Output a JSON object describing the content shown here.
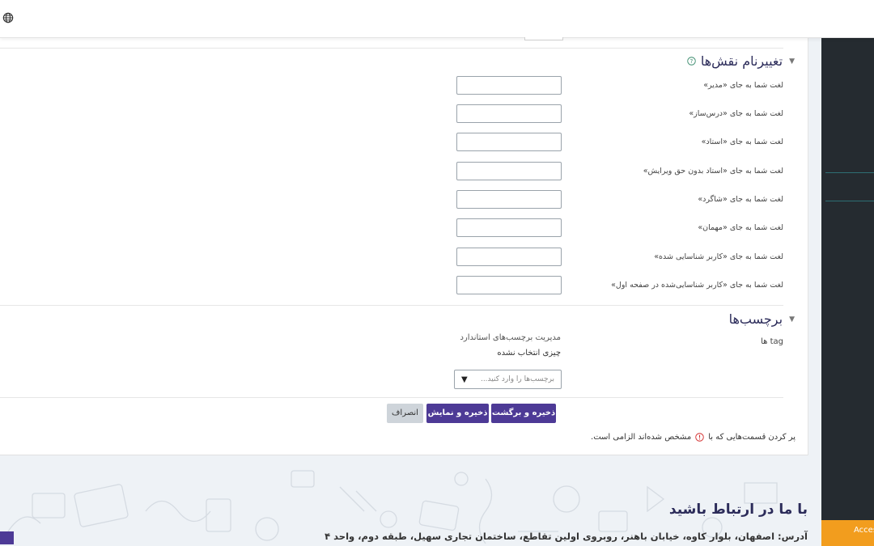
{
  "colors": {
    "accent": "#4d3a96",
    "heading": "#2c2c5a",
    "panel": "#252b30",
    "panel_line": "#2e6e73",
    "access": "#f29d1e",
    "required": "#d32f2f"
  },
  "topbar": {
    "icon": "globe-icon"
  },
  "rename_roles": {
    "title": "تغییرنام نقش‌ها",
    "help_icon": "question-circle-icon",
    "rows": [
      {
        "label": "لغت شما به جای «مدیر»",
        "value": ""
      },
      {
        "label": "لغت شما به جای «درس‌ساز»",
        "value": ""
      },
      {
        "label": "لغت شما به جای «استاد»",
        "value": ""
      },
      {
        "label": "لغت شما به جای «استاد بدون حق ویرایش»",
        "value": ""
      },
      {
        "label": "لغت شما به جای «شاگرد»",
        "value": ""
      },
      {
        "label": "لغت شما به جای «مهمان»",
        "value": ""
      },
      {
        "label": "لغت شما به جای «کاربر شناسایی شده»",
        "value": ""
      },
      {
        "label": "لغت شما به جای «کاربر شناسایی‌شده در صفحه اول»",
        "value": ""
      }
    ]
  },
  "tags": {
    "title": "برچسب‌ها",
    "field_label": "tag ها",
    "manage_link": "مدیریت برچسب‌های استاندارد",
    "nothing_selected": "چیزی انتخاب نشده",
    "placeholder": "برچسب‌ها را وارد کنید...",
    "arrow": "▼"
  },
  "buttons": {
    "save_return": "ذخیره و برگشت",
    "save_display": "ذخیره و نمایش",
    "cancel": "انصراف"
  },
  "required_note": {
    "before": "پر کردن قسمت‌هایی که با",
    "after": "مشخص شده‌اند الزامی است."
  },
  "footer": {
    "title": "با ما در ارتباط باشید",
    "address": "آدرس: اصفهان، بلوار کاوه، خیابان باهنر، روبروی اولین تقاطع، ساختمان تجاری سهیل، طبقه دوم، واحد ۴"
  },
  "accessibility": {
    "label": "Accessibility"
  }
}
